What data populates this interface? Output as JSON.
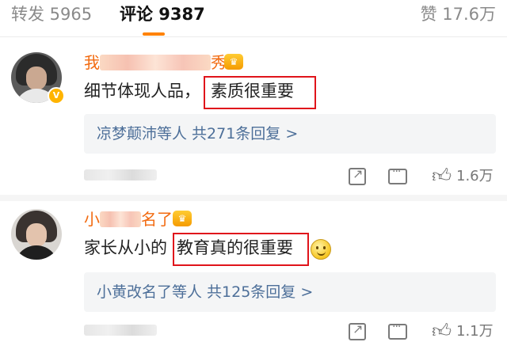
{
  "tabs": {
    "repost": "转发 5965",
    "comment": "评论 9387",
    "like": "赞 17.6万"
  },
  "comments": [
    {
      "username_start": "我",
      "username_end": "秀",
      "text_plain": "细节体现人品，",
      "text_highlight": "素质很重要",
      "reply_summary": "凉梦颠沛等人  共271条回复 >",
      "like_count": "1.6万",
      "verified": true
    },
    {
      "username_start": "小",
      "username_end": "名了",
      "text_plain": "家长从小的",
      "text_highlight": "教育真的很重要",
      "reply_summary": "小黄改名了等人  共125条回复 >",
      "like_count": "1.1万",
      "verified": false
    }
  ],
  "icons": {
    "crown": "crown-icon",
    "verified": "verified-badge-icon",
    "smile": "smile-emoji-icon",
    "share": "share-icon",
    "comment": "comment-icon",
    "like": "thumbs-up-icon"
  },
  "colors": {
    "accent": "#ff8200",
    "username": "#f26a0f",
    "reply_link": "#4d6f99",
    "highlight_box": "#e0141b"
  }
}
